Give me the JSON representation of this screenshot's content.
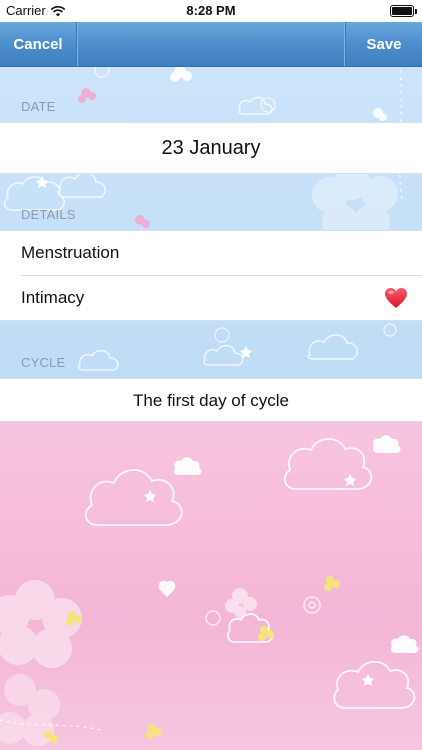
{
  "status_bar": {
    "carrier": "Carrier",
    "time": "8:28 PM",
    "wifi_icon": "wifi-icon",
    "battery_icon": "battery-icon",
    "battery_level": 1.0
  },
  "nav_bar": {
    "cancel_label": "Cancel",
    "save_label": "Save",
    "background_color": "#4d8dcb",
    "text_color": "#ffffff"
  },
  "sections": {
    "date": {
      "header": "DATE",
      "value": "23 January"
    },
    "details": {
      "header": "DETAILS",
      "items": [
        {
          "label": "Menstruation"
        },
        {
          "label": "Intimacy",
          "icon": "heart-icon",
          "icon_color": "#e51f36"
        }
      ]
    },
    "cycle": {
      "header": "CYCLE",
      "value": "The first day of cycle"
    }
  },
  "theme": {
    "top_background": "#cfe6fb",
    "bottom_background": "#f4b6d6",
    "section_header_color": "#8a9bb0"
  }
}
